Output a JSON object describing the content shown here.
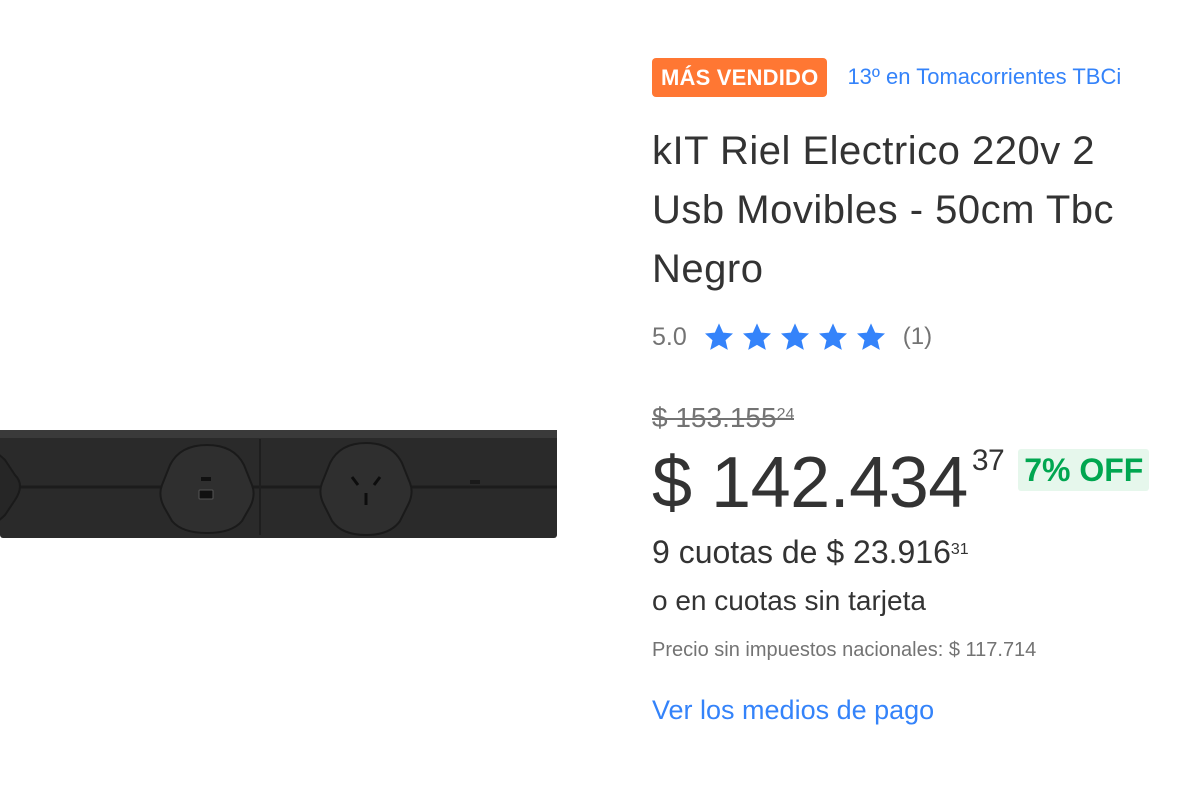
{
  "badge": {
    "label": "MÁS VENDIDO",
    "color": "#ff7733"
  },
  "rank": {
    "label": "13º en Tomacorrientes TBCi"
  },
  "product": {
    "title_lines": [
      "kIT Riel Electrico 220v 2",
      "Usb Movibles - 50cm Tbc",
      "Negro"
    ],
    "image_icon": "power-rail-product-image"
  },
  "rating": {
    "value": "5.0",
    "stars": 5,
    "count": "(1)",
    "star_color": "#3483fa"
  },
  "pricing": {
    "old_price_main": "$ 153.155",
    "old_price_cents": "24",
    "price_main": "$ 142.434",
    "price_cents": "37",
    "discount": "7% OFF",
    "discount_color": "#00a650",
    "installments_main": "9 cuotas de $ 23.916",
    "installments_cents": "31",
    "no_card": "o en cuotas sin tarjeta",
    "tax_note": "Precio sin impuestos nacionales: $ 117.714"
  },
  "links": {
    "payment_methods": "Ver los medios de pago",
    "link_color": "#3483fa"
  }
}
